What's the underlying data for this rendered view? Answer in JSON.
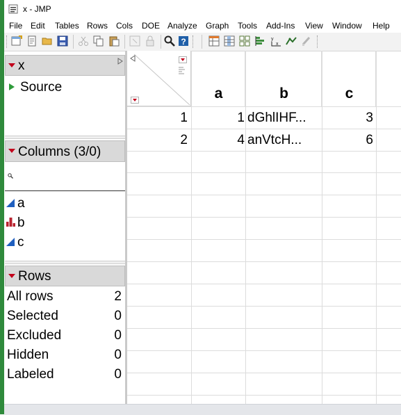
{
  "window": {
    "title": "x - JMP"
  },
  "menu": [
    "File",
    "Edit",
    "Tables",
    "Rows",
    "Cols",
    "DOE",
    "Analyze",
    "Graph",
    "Tools",
    "Add-Ins",
    "View",
    "Window",
    "Help"
  ],
  "toolbar_icons": [
    "new-table-icon",
    "new-script-icon",
    "open-icon",
    "save-icon",
    "cut-icon",
    "copy-icon",
    "paste-icon",
    "copy-table-icon",
    "lock-icon",
    "search-icon",
    "help-icon",
    "data-table-icon",
    "column-info-icon",
    "grid-icon",
    "distribution-icon",
    "fit-y-by-x-icon",
    "fit-model-icon",
    "graph-builder-icon"
  ],
  "table_panel": {
    "name": "x",
    "items": [
      {
        "label": "Source"
      }
    ]
  },
  "columns_panel": {
    "title": "Columns (3/0)",
    "search_value": "",
    "items": [
      {
        "name": "a",
        "type": "continuous",
        "color": "#1f5fbf"
      },
      {
        "name": "b",
        "type": "nominal",
        "color": "#b8232f"
      },
      {
        "name": "c",
        "type": "continuous",
        "color": "#1f5fbf"
      }
    ]
  },
  "rows_panel": {
    "title": "Rows",
    "items": [
      {
        "label": "All rows",
        "value": "2"
      },
      {
        "label": "Selected",
        "value": "0"
      },
      {
        "label": "Excluded",
        "value": "0"
      },
      {
        "label": "Hidden",
        "value": "0"
      },
      {
        "label": "Labeled",
        "value": "0"
      }
    ]
  },
  "grid": {
    "columns": [
      "a",
      "b",
      "c"
    ],
    "rows": [
      {
        "num": "1",
        "a": "1",
        "b": "dGhlIHF...",
        "c": "3"
      },
      {
        "num": "2",
        "a": "4",
        "b": "anVtcH...",
        "c": "6"
      }
    ]
  },
  "colors": {
    "accent_green": "#2f8a3c",
    "marker_red": "#c2001b",
    "continuous_blue": "#1f5fbf",
    "nominal_red": "#b8232f"
  }
}
